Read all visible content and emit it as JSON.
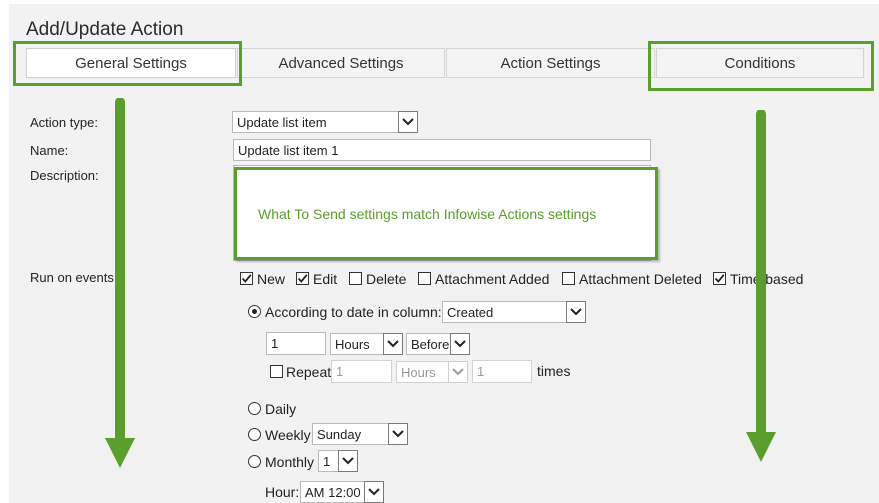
{
  "dialog": {
    "title": "Add/Update Action"
  },
  "tabs": [
    {
      "label": "General Settings"
    },
    {
      "label": "Advanced Settings"
    },
    {
      "label": "Action Settings"
    },
    {
      "label": "Conditions"
    }
  ],
  "form": {
    "action_type_label": "Action type:",
    "action_type_value": "Update list item",
    "name_label": "Name:",
    "name_value": "Update list item 1",
    "description_label": "Description:",
    "run_on_events_label": "Run on events"
  },
  "callout": {
    "text": "What To Send settings match Infowise Actions settings"
  },
  "events": [
    {
      "label": "New",
      "checked": true
    },
    {
      "label": "Edit",
      "checked": true
    },
    {
      "label": "Delete",
      "checked": false
    },
    {
      "label": "Attachment Added",
      "checked": false
    },
    {
      "label": "Attachment Deleted",
      "checked": false
    },
    {
      "label": "Time-based",
      "checked": true
    }
  ],
  "schedule": {
    "according_label": "According to date in column:",
    "column_value": "Created",
    "offset_value": "1",
    "unit_value": "Hours",
    "direction_value": "Before",
    "repeat_label": "Repeat",
    "repeat_count": "1",
    "repeat_unit": "Hours",
    "repeat_times": "1",
    "times_label": "times",
    "daily_label": "Daily",
    "weekly_label": "Weekly",
    "weekly_day": "Sunday",
    "monthly_label": "Monthly",
    "monthly_day": "1",
    "hour_label": "Hour:",
    "hour_value": "AM 12:00"
  },
  "colors": {
    "highlight": "#5a9e2d",
    "panel_bg": "#f2f2f2"
  }
}
